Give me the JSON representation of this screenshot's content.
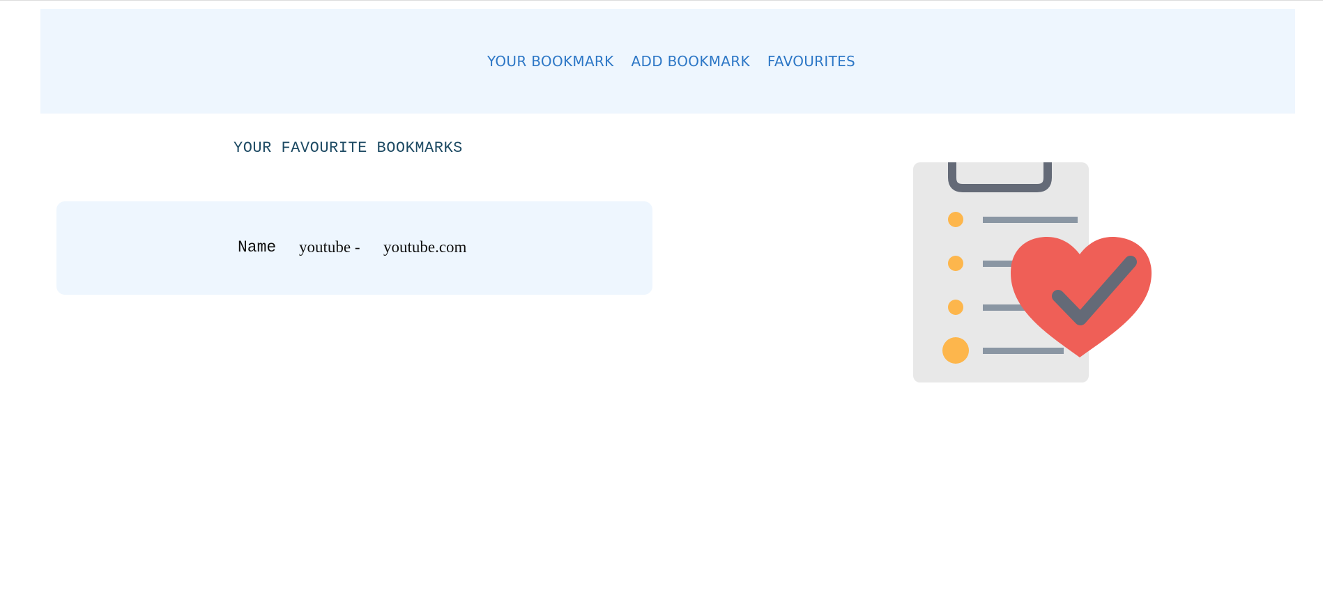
{
  "nav": {
    "links": [
      {
        "label": "YOUR BOOKMARK"
      },
      {
        "label": "ADD BOOKMARK"
      },
      {
        "label": "FAVOURITES"
      }
    ]
  },
  "main": {
    "title": "YOUR FAVOURITE BOOKMARKS",
    "bookmarks": [
      {
        "label": "Name",
        "name": "youtube -",
        "url": "youtube.com"
      }
    ]
  },
  "illustration": {
    "icon": "clipboard-heart-checkmark-icon"
  },
  "colors": {
    "nav_bg": "#eef6fe",
    "nav_link": "#2d77c6",
    "title": "#1d4a63",
    "card_bg": "#eef6fe",
    "heart": "#ef5f57",
    "clipboard": "#e8e8e8",
    "bullet": "#fdb64c",
    "line": "#8a96a3",
    "clip": "#646a77"
  }
}
